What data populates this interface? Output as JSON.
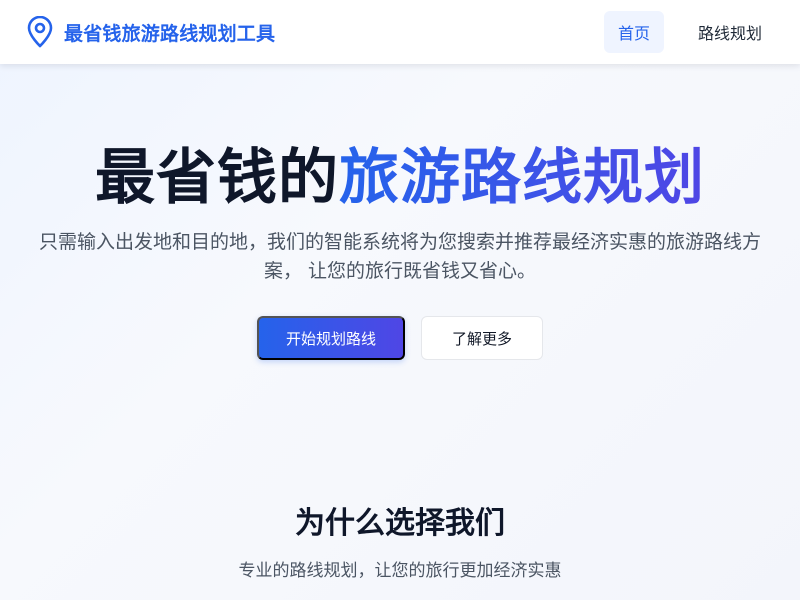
{
  "header": {
    "brand_icon": "map-pin-icon",
    "brand_title": "最省钱旅游路线规划工具",
    "nav": [
      {
        "label": "首页",
        "active": true
      },
      {
        "label": "路线规划",
        "active": false
      }
    ]
  },
  "hero": {
    "title_plain": "最省钱的",
    "title_highlight": "旅游路线规划",
    "description": "只需输入出发地和目的地，我们的智能系统将为您搜索并推荐最经济实惠的旅游路线方案， 让您的旅行既省钱又省心。",
    "primary_button": "开始规划路线",
    "secondary_button": "了解更多"
  },
  "features": {
    "title": "为什么选择我们",
    "subtitle": "专业的路线规划，让您的旅行更加经济实惠"
  },
  "colors": {
    "accent": "#2563eb",
    "accent_end": "#4f46e5",
    "text_dark": "#0f172a",
    "text_muted": "#4b5563"
  }
}
